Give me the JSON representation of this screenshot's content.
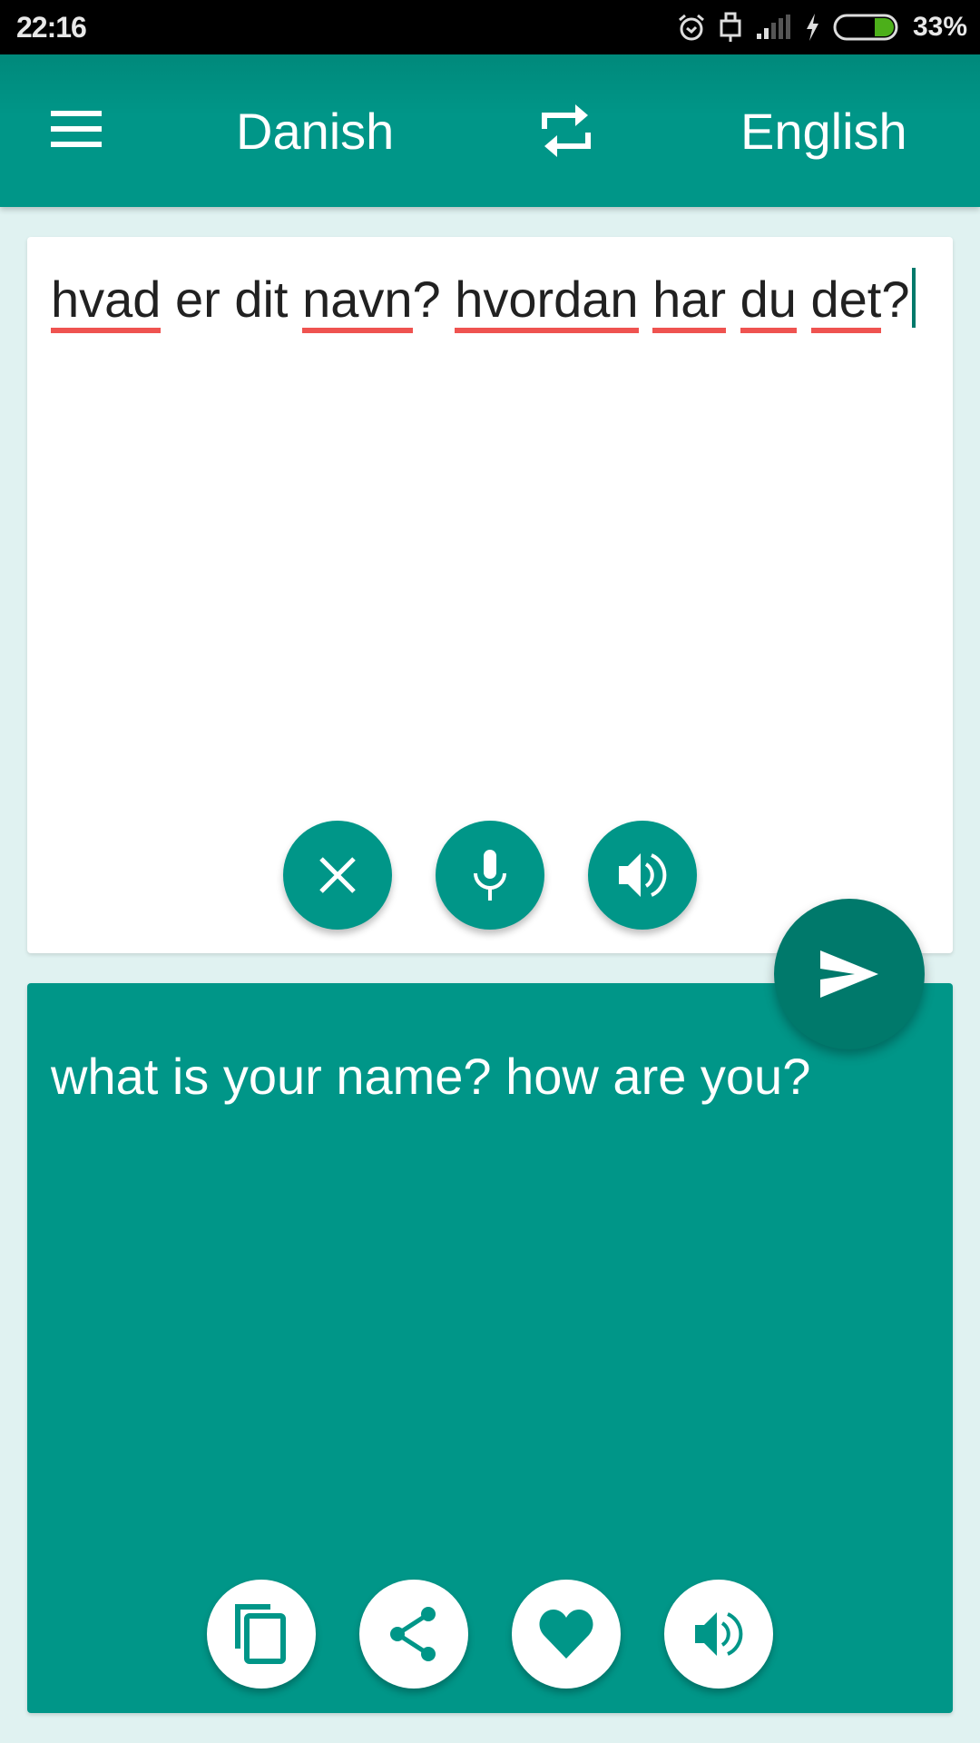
{
  "status_bar": {
    "time": "22:16",
    "battery_percent": "33%",
    "battery_level": 0.33,
    "icons": [
      "alarm-icon",
      "usb-icon",
      "signal-icon",
      "charging-icon",
      "battery-icon"
    ]
  },
  "header": {
    "menu_icon": "hamburger-menu-icon",
    "source_language": "Danish",
    "swap_icon": "swap-languages-icon",
    "target_language": "English"
  },
  "input": {
    "words": [
      {
        "text": "hvad",
        "misspelled": true
      },
      {
        "text": " er dit ",
        "misspelled": false
      },
      {
        "text": "navn",
        "misspelled": true
      },
      {
        "text": "? ",
        "misspelled": false
      },
      {
        "text": "hvordan",
        "misspelled": true
      },
      {
        "text": " ",
        "misspelled": false
      },
      {
        "text": "har",
        "misspelled": true
      },
      {
        "text": " ",
        "misspelled": false
      },
      {
        "text": "du",
        "misspelled": true
      },
      {
        "text": " ",
        "misspelled": false
      },
      {
        "text": "det",
        "misspelled": true
      },
      {
        "text": "?",
        "misspelled": false
      }
    ],
    "value": "hvad er dit navn? hvordan har du det?",
    "buttons": [
      {
        "name": "clear",
        "icon": "close-icon"
      },
      {
        "name": "voice-input",
        "icon": "microphone-icon"
      },
      {
        "name": "speak-source",
        "icon": "speaker-icon"
      }
    ]
  },
  "translate_button": {
    "icon": "send-icon"
  },
  "output": {
    "value": "what is your name? how are you?",
    "buttons": [
      {
        "name": "copy",
        "icon": "copy-icon"
      },
      {
        "name": "share",
        "icon": "share-icon"
      },
      {
        "name": "favorite",
        "icon": "heart-icon"
      },
      {
        "name": "speak-translation",
        "icon": "speaker-icon"
      }
    ]
  },
  "colors": {
    "primary": "#009688",
    "primary_dark": "#00796b",
    "background": "#e0f2f1",
    "spellcheck_underline": "#ef5350",
    "battery_fill": "#4caf1a"
  }
}
